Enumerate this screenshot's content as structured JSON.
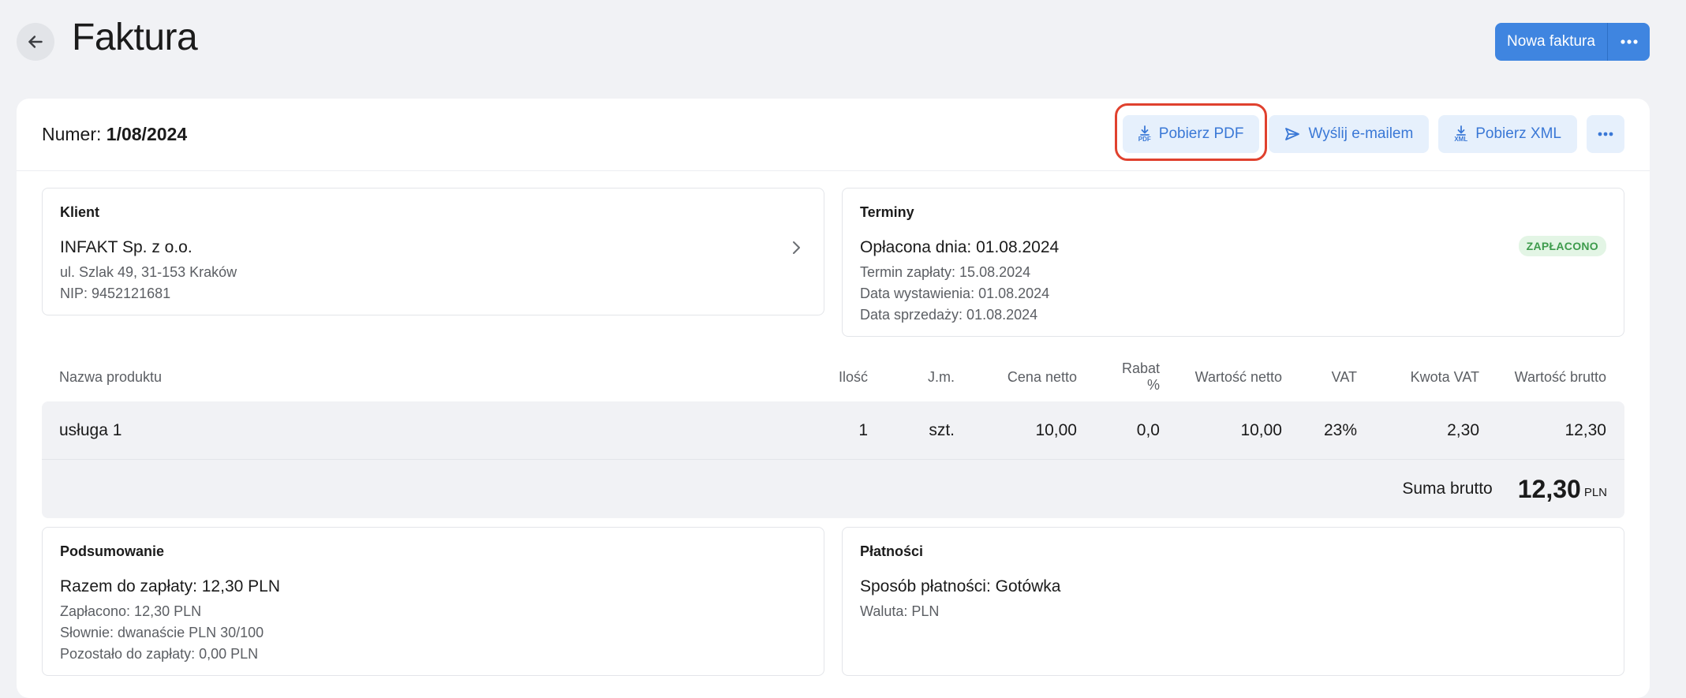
{
  "header": {
    "title": "Faktura",
    "new_invoice_label": "Nowa faktura"
  },
  "invoice": {
    "number_label": "Numer:",
    "number_value": "1/08/2024"
  },
  "actions": {
    "pdf_label": "Pobierz PDF",
    "pdf_icon_text": "PDF",
    "email_label": "Wyślij e-mailem",
    "xml_label": "Pobierz XML",
    "xml_icon_text": "XML"
  },
  "client": {
    "title": "Klient",
    "name": "INFAKT Sp. z o.o.",
    "address": "ul. Szlak 49, 31-153 Kraków",
    "nip": "NIP: 9452121681"
  },
  "terms": {
    "title": "Terminy",
    "paid_on": "Opłacona dnia: 01.08.2024",
    "due": "Termin zapłaty: 15.08.2024",
    "issued": "Data wystawienia: 01.08.2024",
    "sale": "Data sprzedaży: 01.08.2024",
    "status_badge": "ZAPŁACONO"
  },
  "table": {
    "headers": {
      "name": "Nazwa produktu",
      "qty": "Ilość",
      "unit": "J.m.",
      "net_price": "Cena netto",
      "discount": "Rabat %",
      "net_value": "Wartość netto",
      "vat": "VAT",
      "vat_amount": "Kwota VAT",
      "gross_value": "Wartość brutto"
    },
    "rows": [
      {
        "name": "usługa 1",
        "qty": "1",
        "unit": "szt.",
        "net_price": "10,00",
        "discount": "0,0",
        "net_value": "10,00",
        "vat": "23%",
        "vat_amount": "2,30",
        "gross_value": "12,30"
      }
    ],
    "total_label": "Suma brutto",
    "total_value": "12,30",
    "total_currency": "PLN"
  },
  "summary": {
    "title": "Podsumowanie",
    "to_pay": "Razem do zapłaty: 12,30 PLN",
    "paid": "Zapłacono: 12,30 PLN",
    "in_words": "Słownie: dwanaście PLN 30/100",
    "remaining": "Pozostało do zapłaty: 0,00 PLN"
  },
  "payments": {
    "title": "Płatności",
    "method": "Sposób płatności: Gotówka",
    "currency": "Waluta: PLN"
  },
  "colors": {
    "primary": "#3f85e0",
    "highlight": "#e0412e",
    "badge_green": "#3d9b4c"
  }
}
